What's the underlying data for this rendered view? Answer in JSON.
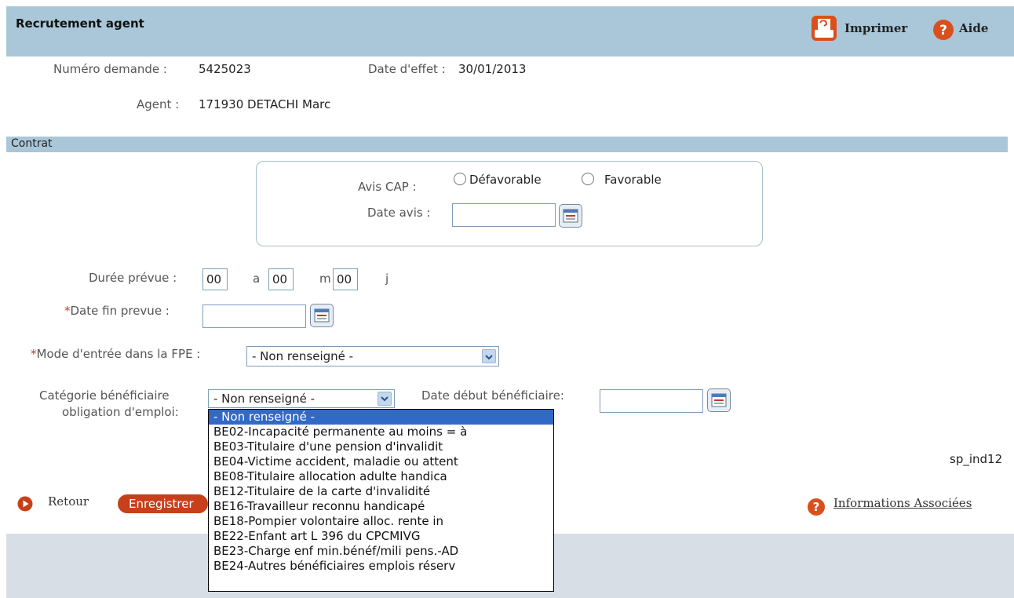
{
  "header": {
    "title": "Recrutement agent",
    "print_label": "Imprimer",
    "help_label": "Aide"
  },
  "info": {
    "numero_label": "Numéro demande :",
    "numero_value": "5425023",
    "date_effet_label": "Date d'effet :",
    "date_effet_value": "30/01/2013",
    "agent_label": "Agent :",
    "agent_value": "171930 DETACHI Marc"
  },
  "section": {
    "title": "Contrat"
  },
  "cap": {
    "avis_label": "Avis CAP :",
    "option_defavorable": "Défavorable",
    "option_favorable": "Favorable",
    "date_avis_label": "Date avis :",
    "date_avis_value": ""
  },
  "duree": {
    "label": "Durée prévue :",
    "years": "00",
    "years_unit": "a",
    "months": "00",
    "months_unit": "m",
    "days": "00",
    "days_unit": "j"
  },
  "date_fin": {
    "required_mark": "*",
    "label": "Date fin prevue :",
    "value": ""
  },
  "mode_entree": {
    "required_mark": "*",
    "label": "Mode d'entrée dans la FPE :",
    "selected": "- Non renseigné -"
  },
  "categorie": {
    "label_line1": "Catégorie bénéficiaire",
    "label_line2": "obligation d'emploi:",
    "selected": "- Non renseigné -",
    "options": [
      "- Non renseigné -",
      "BE02-Incapacité permanente au moins = à",
      "BE03-Titulaire d'une pension d'invalidit",
      "BE04-Victime accident, maladie ou attent",
      "BE08-Titulaire allocation adulte handica",
      "BE12-Titulaire de la carte d'invalidité",
      "BE16-Travailleur reconnu handicapé",
      "BE18-Pompier volontaire alloc. rente in",
      "BE22-Enfant art L 396 du CPCMIVG",
      "BE23-Charge enf min.bénéf/mili pens.-AD",
      "BE24-Autres bénéficiaires emplois réserv"
    ]
  },
  "date_debut_benef": {
    "label": "Date début bénéficiaire:",
    "value": ""
  },
  "page_code": "sp_ind12",
  "actions": {
    "retour_label": "Retour",
    "enregistrer_label": "Enregistrer"
  },
  "info_associees_label": "Informations Associées",
  "colors": {
    "header_bg": "#a9c7d8",
    "accent_orange": "#c7401a",
    "selection_blue": "#3169c6"
  }
}
